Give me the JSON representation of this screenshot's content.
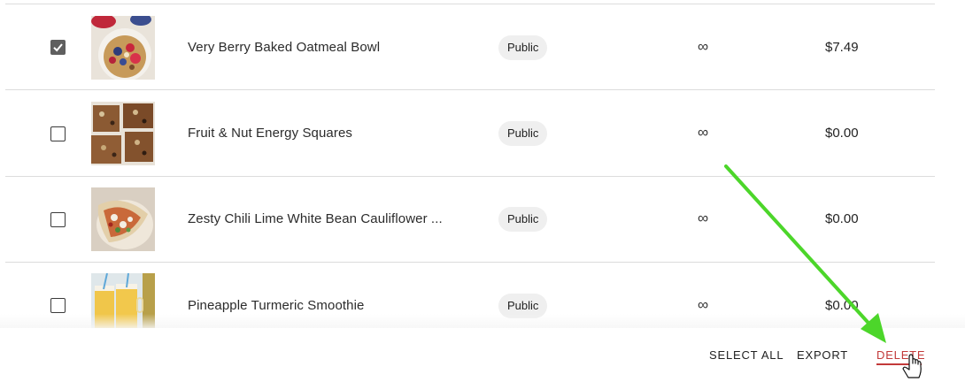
{
  "products": [
    {
      "checked": true,
      "name": "Very Berry Baked Oatmeal Bowl",
      "visibility": "Public",
      "stock": "∞",
      "price": "$7.49",
      "thumb_icon": "oatmeal-bowl-photo"
    },
    {
      "checked": false,
      "name": "Fruit & Nut Energy Squares",
      "visibility": "Public",
      "stock": "∞",
      "price": "$0.00",
      "thumb_icon": "energy-squares-photo"
    },
    {
      "checked": false,
      "name": "Zesty Chili Lime White Bean Cauliflower ...",
      "visibility": "Public",
      "stock": "∞",
      "price": "$0.00",
      "thumb_icon": "cauliflower-wrap-photo"
    },
    {
      "checked": false,
      "name": "Pineapple Turmeric Smoothie",
      "visibility": "Public",
      "stock": "∞",
      "price": "$0.00",
      "thumb_icon": "smoothie-photo"
    }
  ],
  "actions": {
    "select_all": "SELECT ALL",
    "export": "EXPORT",
    "delete": "DELETE"
  },
  "colors": {
    "delete": "#c23a3a",
    "annotation_arrow": "#4cd62a",
    "checkbox_checked": "#5f5f5f"
  }
}
